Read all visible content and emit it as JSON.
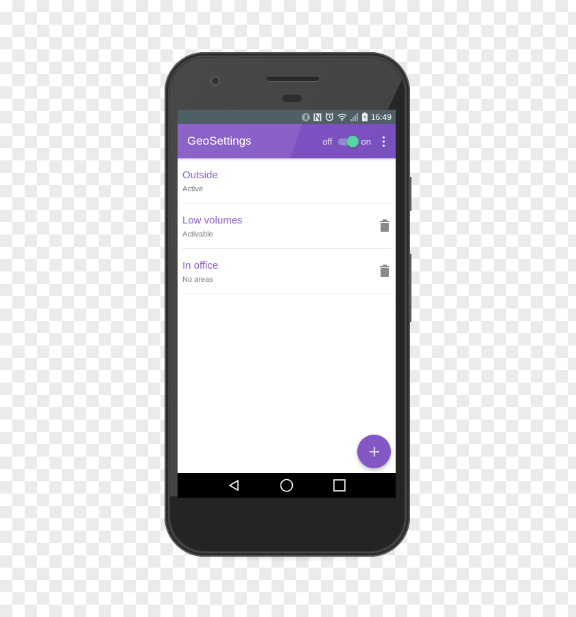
{
  "statusbar": {
    "time": "16:49",
    "icons": [
      "bluetooth-icon",
      "nfc-icon",
      "alarm-icon",
      "wifi-icon",
      "signal-icon",
      "battery-icon"
    ]
  },
  "appbar": {
    "title": "GeoSettings",
    "toggle_off_label": "off",
    "toggle_on_label": "on",
    "toggle_state": "on",
    "menu_icon": "more-vert-icon"
  },
  "profiles": [
    {
      "title": "Outside",
      "status": "Active",
      "deletable": false
    },
    {
      "title": "Low volumes",
      "status": "Activable",
      "deletable": true
    },
    {
      "title": "In office",
      "status": "No areas",
      "deletable": true
    }
  ],
  "fab": {
    "icon": "plus-icon"
  },
  "navbar": {
    "icons": [
      "back-icon",
      "home-icon",
      "recents-icon"
    ]
  },
  "colors": {
    "accent": "#8358c6",
    "appbar": "#8860c6",
    "statusbar": "#4e5f66",
    "toggle_thumb": "#54d6a0",
    "item_title": "#8a5dc8"
  }
}
